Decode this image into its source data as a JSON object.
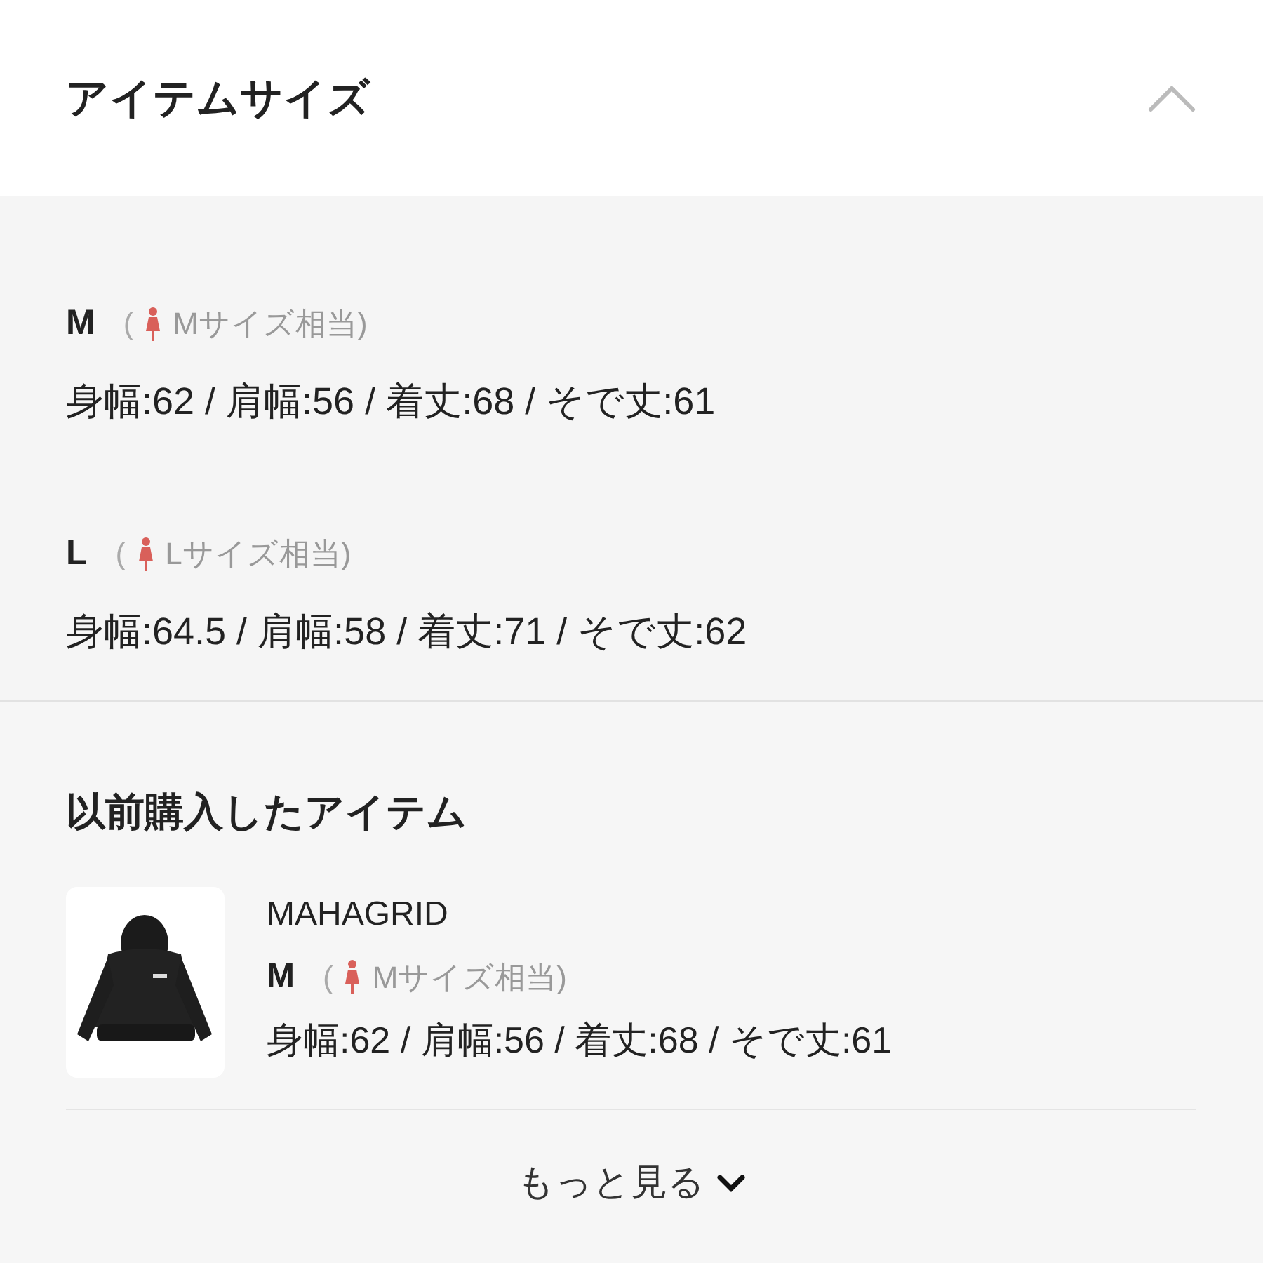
{
  "header": {
    "title": "アイテムサイズ",
    "expanded": true
  },
  "sizes": [
    {
      "size": "M",
      "open": "(",
      "equivalent": "Mサイズ相当)",
      "specs": "身幅:62 / 肩幅:56 / 着丈:68 / そで丈:61"
    },
    {
      "size": "L",
      "open": "(",
      "equivalent": "Lサイズ相当)",
      "specs": "身幅:64.5 / 肩幅:58 / 着丈:71 / そで丈:62"
    }
  ],
  "previous": {
    "title": "以前購入したアイテム",
    "items": [
      {
        "brand": "MAHAGRID",
        "size": "M",
        "open": "(",
        "equivalent": "Mサイズ相当)",
        "specs": "身幅:62 / 肩幅:56 / 着丈:68 / そで丈:61"
      }
    ],
    "more": "もっと見る"
  }
}
